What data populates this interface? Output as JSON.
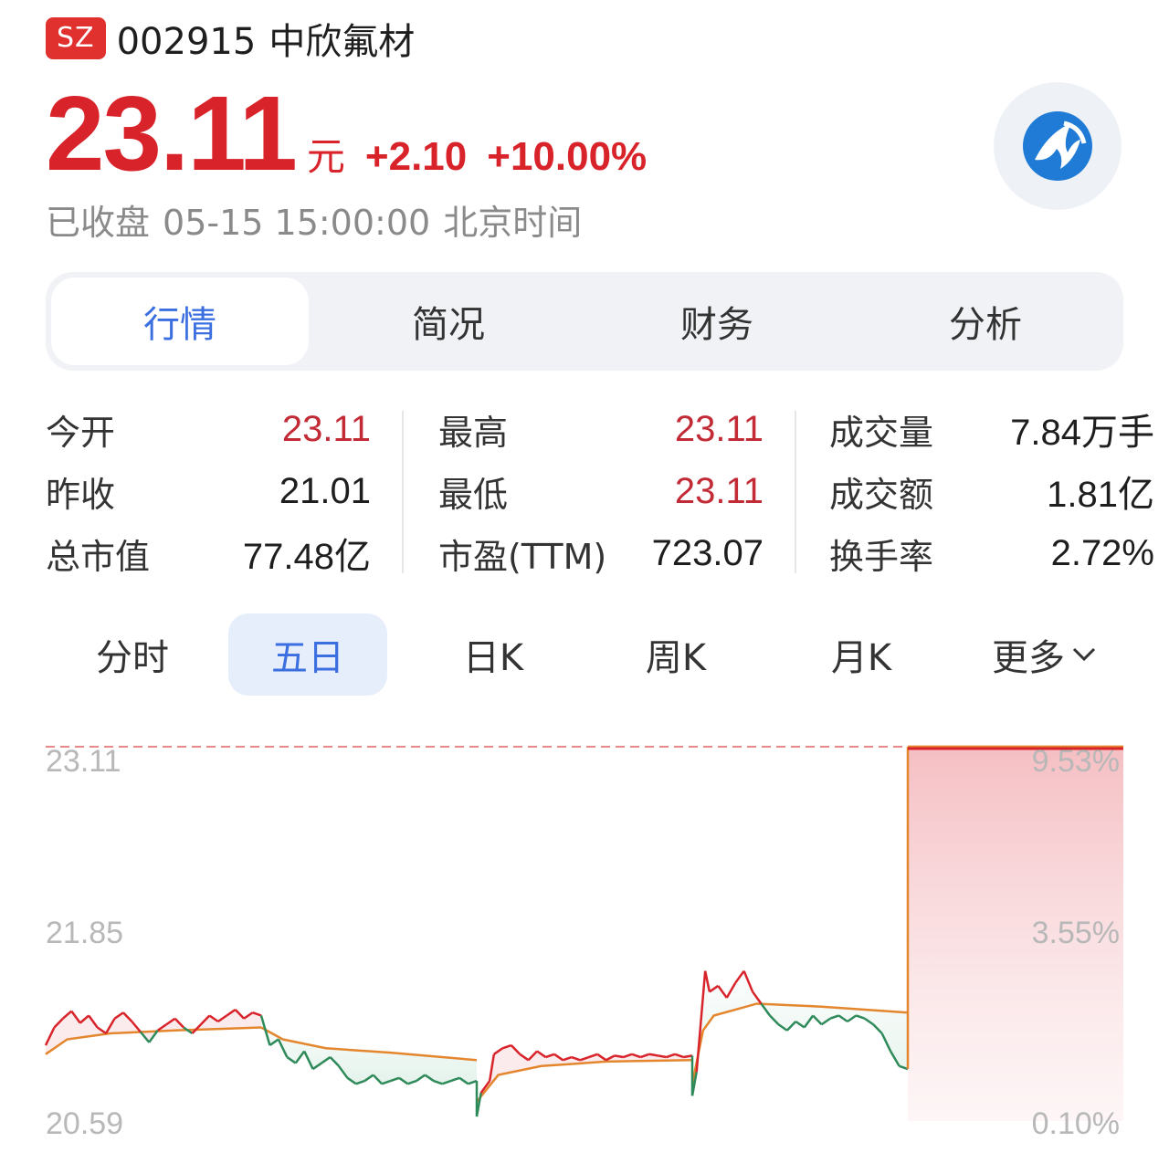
{
  "header": {
    "market": "SZ",
    "code": "002915",
    "name": "中欣氟材"
  },
  "quote": {
    "price": "23.11",
    "unit": "元",
    "change": "+2.10",
    "change_pct": "+10.00%",
    "status": "已收盘",
    "time": "05-15 15:00:00",
    "timezone": "北京时间"
  },
  "tabs": [
    {
      "label": "行情",
      "active": true
    },
    {
      "label": "简况",
      "active": false
    },
    {
      "label": "财务",
      "active": false
    },
    {
      "label": "分析",
      "active": false
    }
  ],
  "stats": [
    [
      {
        "label": "今开",
        "value": "23.11",
        "red": true
      },
      {
        "label": "昨收",
        "value": "21.01",
        "red": false
      },
      {
        "label": "总市值",
        "value": "77.48亿",
        "red": false
      }
    ],
    [
      {
        "label": "最高",
        "value": "23.11",
        "red": true
      },
      {
        "label": "最低",
        "value": "23.11",
        "red": true
      },
      {
        "label": "市盈(TTM)",
        "value": "723.07",
        "red": false
      }
    ],
    [
      {
        "label": "成交量",
        "value": "7.84万手",
        "red": false
      },
      {
        "label": "成交额",
        "value": "1.81亿",
        "red": false
      },
      {
        "label": "换手率",
        "value": "2.72%",
        "red": false
      }
    ]
  ],
  "periods": [
    {
      "label": "分时",
      "active": false
    },
    {
      "label": "五日",
      "active": true
    },
    {
      "label": "日K",
      "active": false
    },
    {
      "label": "周K",
      "active": false
    },
    {
      "label": "月K",
      "active": false
    },
    {
      "label": "更多",
      "active": false,
      "dropdown": true
    }
  ],
  "colors": {
    "up": "#d8232a",
    "down": "#2f8a5a",
    "avg_line": "#e3862e",
    "accent": "#3b6fe0",
    "ref_dashed": "#e88a8a"
  },
  "chart_data": {
    "type": "line",
    "title": "",
    "xlabel": "",
    "ylabel": "",
    "ylim": [
      20.59,
      23.11
    ],
    "y_tick_labels_left": [
      "23.11",
      "21.85",
      "20.59"
    ],
    "y_tick_labels_right": [
      "9.53%",
      "3.55%",
      "0.10%"
    ],
    "days": 5,
    "series": [
      {
        "key": "price",
        "segments": [
          [
            [
              0.0,
              21.1
            ],
            [
              0.04,
              21.22
            ],
            [
              0.08,
              21.28
            ],
            [
              0.12,
              21.33
            ],
            [
              0.16,
              21.25
            ],
            [
              0.2,
              21.3
            ],
            [
              0.24,
              21.22
            ],
            [
              0.28,
              21.18
            ],
            [
              0.32,
              21.28
            ],
            [
              0.36,
              21.32
            ],
            [
              0.4,
              21.26
            ],
            [
              0.44,
              21.19
            ],
            [
              0.48,
              21.12
            ],
            [
              0.52,
              21.2
            ],
            [
              0.56,
              21.24
            ],
            [
              0.6,
              21.28
            ],
            [
              0.64,
              21.22
            ],
            [
              0.68,
              21.18
            ],
            [
              0.72,
              21.24
            ],
            [
              0.76,
              21.3
            ],
            [
              0.8,
              21.26
            ],
            [
              0.84,
              21.3
            ],
            [
              0.88,
              21.34
            ],
            [
              0.92,
              21.28
            ],
            [
              0.96,
              21.32
            ],
            [
              1.0,
              21.3
            ]
          ],
          [
            [
              1.0,
              21.3
            ],
            [
              1.04,
              21.1
            ],
            [
              1.08,
              21.14
            ],
            [
              1.12,
              21.02
            ],
            [
              1.16,
              20.98
            ],
            [
              1.2,
              21.06
            ],
            [
              1.24,
              20.94
            ],
            [
              1.28,
              20.98
            ],
            [
              1.32,
              21.02
            ],
            [
              1.36,
              20.96
            ],
            [
              1.4,
              20.88
            ],
            [
              1.44,
              20.84
            ],
            [
              1.48,
              20.86
            ],
            [
              1.52,
              20.9
            ],
            [
              1.56,
              20.84
            ],
            [
              1.6,
              20.86
            ],
            [
              1.64,
              20.88
            ],
            [
              1.68,
              20.84
            ],
            [
              1.72,
              20.86
            ],
            [
              1.76,
              20.9
            ],
            [
              1.8,
              20.86
            ],
            [
              1.84,
              20.84
            ],
            [
              1.88,
              20.86
            ],
            [
              1.92,
              20.88
            ],
            [
              1.96,
              20.84
            ],
            [
              2.0,
              20.86
            ]
          ],
          [
            [
              2.0,
              20.62
            ],
            [
              2.02,
              20.78
            ],
            [
              2.06,
              20.86
            ],
            [
              2.08,
              21.04
            ],
            [
              2.12,
              21.08
            ],
            [
              2.16,
              21.1
            ],
            [
              2.2,
              21.04
            ],
            [
              2.24,
              21.0
            ],
            [
              2.28,
              21.06
            ],
            [
              2.32,
              21.02
            ],
            [
              2.36,
              21.04
            ],
            [
              2.4,
              21.0
            ],
            [
              2.44,
              21.02
            ],
            [
              2.48,
              21.0
            ],
            [
              2.52,
              21.02
            ],
            [
              2.56,
              21.04
            ],
            [
              2.6,
              21.0
            ],
            [
              2.64,
              21.03
            ],
            [
              2.68,
              21.02
            ],
            [
              2.72,
              21.04
            ],
            [
              2.76,
              21.02
            ],
            [
              2.8,
              21.04
            ],
            [
              2.84,
              21.03
            ],
            [
              2.88,
              21.02
            ],
            [
              2.92,
              21.04
            ],
            [
              2.96,
              21.02
            ],
            [
              3.0,
              21.03
            ]
          ],
          [
            [
              3.0,
              20.76
            ],
            [
              3.02,
              20.92
            ],
            [
              3.04,
              21.26
            ],
            [
              3.06,
              21.6
            ],
            [
              3.08,
              21.46
            ],
            [
              3.12,
              21.5
            ],
            [
              3.16,
              21.42
            ],
            [
              3.2,
              21.52
            ],
            [
              3.24,
              21.6
            ],
            [
              3.28,
              21.46
            ],
            [
              3.32,
              21.38
            ],
            [
              3.36,
              21.3
            ],
            [
              3.4,
              21.24
            ],
            [
              3.44,
              21.2
            ],
            [
              3.48,
              21.26
            ],
            [
              3.52,
              21.22
            ],
            [
              3.56,
              21.3
            ],
            [
              3.6,
              21.24
            ],
            [
              3.64,
              21.28
            ],
            [
              3.68,
              21.3
            ],
            [
              3.72,
              21.26
            ],
            [
              3.76,
              21.3
            ],
            [
              3.8,
              21.28
            ],
            [
              3.84,
              21.24
            ],
            [
              3.88,
              21.18
            ],
            [
              3.92,
              21.06
            ],
            [
              3.96,
              20.96
            ],
            [
              4.0,
              20.94
            ]
          ],
          [
            [
              4.0,
              23.11
            ],
            [
              5.0,
              23.11
            ]
          ]
        ]
      },
      {
        "key": "average",
        "segments": [
          [
            [
              0.0,
              21.04
            ],
            [
              0.1,
              21.14
            ],
            [
              0.3,
              21.18
            ],
            [
              0.6,
              21.2
            ],
            [
              1.0,
              21.22
            ]
          ],
          [
            [
              1.0,
              21.22
            ],
            [
              1.1,
              21.14
            ],
            [
              1.3,
              21.08
            ],
            [
              1.6,
              21.05
            ],
            [
              2.0,
              21.0
            ]
          ],
          [
            [
              2.0,
              20.72
            ],
            [
              2.1,
              20.9
            ],
            [
              2.3,
              20.96
            ],
            [
              2.6,
              20.99
            ],
            [
              3.0,
              21.0
            ]
          ],
          [
            [
              3.0,
              20.84
            ],
            [
              3.05,
              21.2
            ],
            [
              3.1,
              21.3
            ],
            [
              3.3,
              21.38
            ],
            [
              3.6,
              21.36
            ],
            [
              4.0,
              21.32
            ]
          ],
          [
            [
              4.0,
              23.11
            ],
            [
              5.0,
              23.11
            ]
          ]
        ]
      }
    ]
  }
}
